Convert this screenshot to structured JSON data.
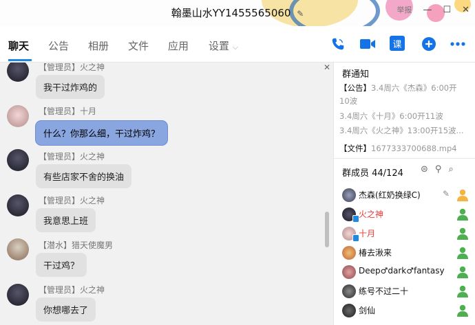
{
  "window": {
    "title": "翰墨山水YY1455565060",
    "report_label": "举报",
    "minimize": "—",
    "maximize": "☐",
    "close": "✕"
  },
  "tabs": [
    {
      "label": "聊天"
    },
    {
      "label": "公告"
    },
    {
      "label": "相册"
    },
    {
      "label": "文件"
    },
    {
      "label": "应用"
    },
    {
      "label": "设置"
    }
  ],
  "toolbar": {
    "phone_icon": "phone-icon",
    "video_icon": "video-icon",
    "class_label": "课",
    "add_icon": "plus-circle-icon",
    "more_icon": "more-icon"
  },
  "messages": [
    {
      "sender": "【管理员】火之神",
      "text": "我干过炸鸡的"
    },
    {
      "sender": "【管理员】十月",
      "text": "什么？你那么细，干过炸鸡？"
    },
    {
      "sender": "【管理员】火之神",
      "text": "有些店家不舍的换油"
    },
    {
      "sender": "【管理员】火之神",
      "text": "我意思上班"
    },
    {
      "sender": "【潜水】猎天使魔男",
      "text": "干过鸡？"
    },
    {
      "sender": "【管理员】火之神",
      "text": "你想哪去了"
    }
  ],
  "notice": {
    "title": "群通知",
    "announcement_tag": "【公告】",
    "line1": "3.4周六《杰森》6:00开",
    "line2": "10波",
    "line3": "3.4周六《十月》6:00开11波",
    "line4": "3.4周六《火之神》13:00开15波...",
    "file_tag": "【文件】",
    "file_name": "1677333700688.mp4"
  },
  "members": {
    "title": "群成员 44/124",
    "list": [
      {
        "name": "杰森(红奶换绿C)",
        "color": "#111111"
      },
      {
        "name": "火之神",
        "color": "#e53935"
      },
      {
        "name": "十月",
        "color": "#e53935"
      },
      {
        "name": "椿去湫来",
        "color": "#111111"
      },
      {
        "name": "Deep♂dark♂fantasy",
        "color": "#111111"
      },
      {
        "name": "练号不过二十",
        "color": "#111111"
      },
      {
        "name": "剑仙",
        "color": "#111111"
      }
    ]
  },
  "colors": {
    "accent": "#1e88e5",
    "admin_name": "#e53935",
    "selected_bubble": "#8aa6e0"
  }
}
